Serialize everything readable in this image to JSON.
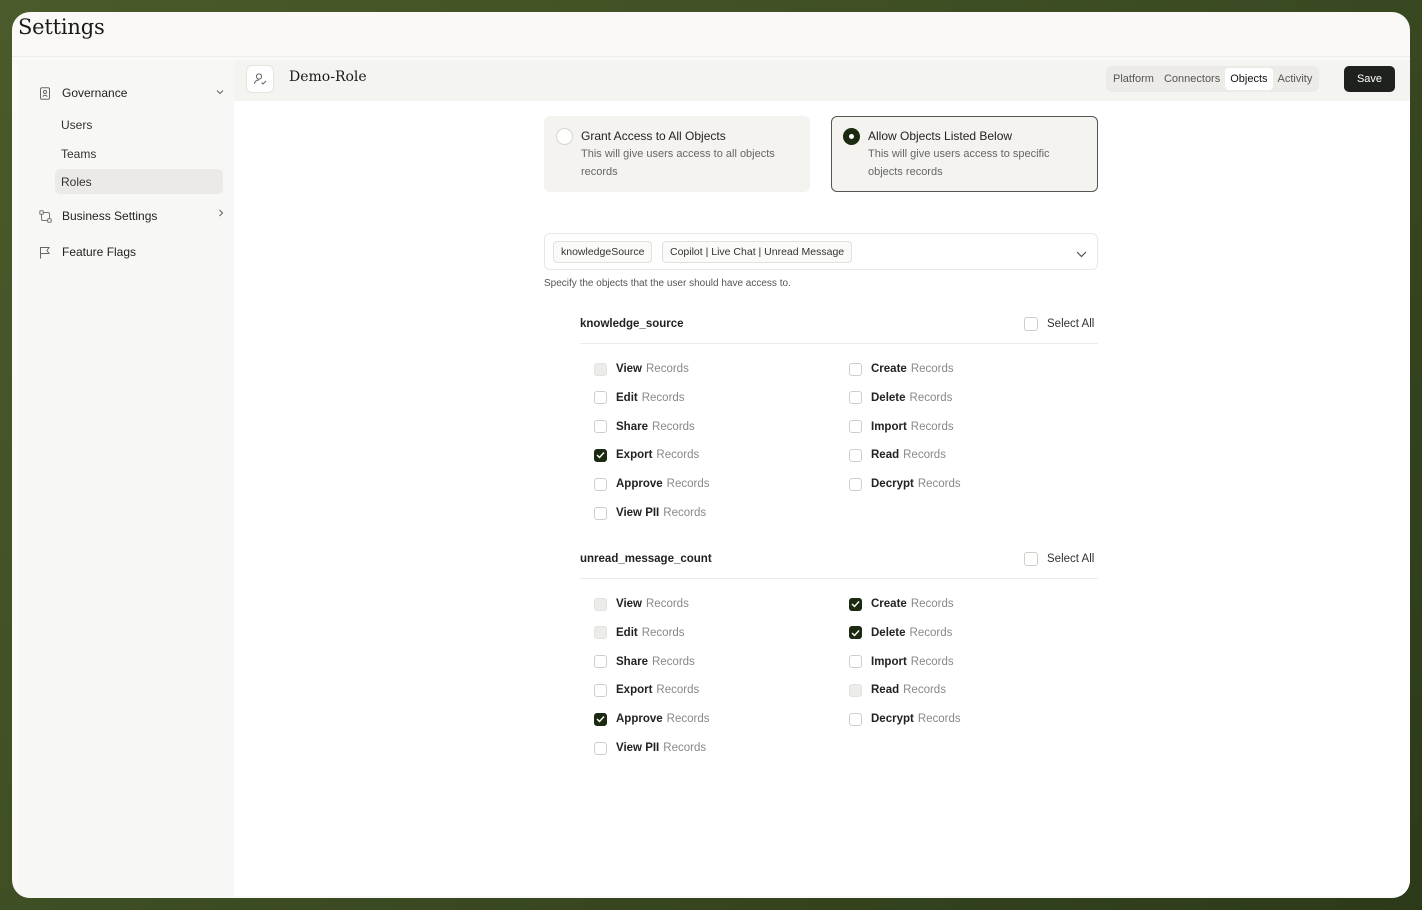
{
  "app": {
    "title": "Settings"
  },
  "sidebar": {
    "governance": {
      "label": "Governance",
      "items": [
        {
          "label": "Users"
        },
        {
          "label": "Teams"
        },
        {
          "label": "Roles"
        }
      ]
    },
    "business_settings": {
      "label": "Business Settings"
    },
    "feature_flags": {
      "label": "Feature Flags"
    }
  },
  "header": {
    "role_name": "Demo-Role",
    "tabs": [
      {
        "label": "Platform"
      },
      {
        "label": "Connectors"
      },
      {
        "label": "Objects"
      },
      {
        "label": "Activity"
      }
    ],
    "active_tab": "Objects",
    "save_label": "Save"
  },
  "access": {
    "options": [
      {
        "title": "Grant Access to All Objects",
        "desc": "This will give users access to all objects records",
        "selected": false
      },
      {
        "title": "Allow Objects Listed Below",
        "desc": "This will give users access to specific objects records",
        "selected": true
      }
    ]
  },
  "objects_select": {
    "chips": [
      "knowledgeSource",
      "Copilot | Live Chat | Unread Message"
    ],
    "helper": "Specify the objects that the user should have access to."
  },
  "records_word": "Records",
  "select_all_label": "Select All",
  "objects": [
    {
      "name": "knowledge_source",
      "perms": [
        {
          "name": "View",
          "state": "disabled"
        },
        {
          "name": "Create",
          "state": "unchecked"
        },
        {
          "name": "Edit",
          "state": "unchecked"
        },
        {
          "name": "Delete",
          "state": "unchecked"
        },
        {
          "name": "Share",
          "state": "unchecked"
        },
        {
          "name": "Import",
          "state": "unchecked"
        },
        {
          "name": "Export",
          "state": "checked"
        },
        {
          "name": "Read",
          "state": "unchecked"
        },
        {
          "name": "Approve",
          "state": "unchecked"
        },
        {
          "name": "Decrypt",
          "state": "unchecked"
        },
        {
          "name": "View PII",
          "state": "unchecked"
        }
      ]
    },
    {
      "name": "unread_message_count",
      "perms": [
        {
          "name": "View",
          "state": "disabled"
        },
        {
          "name": "Create",
          "state": "checked"
        },
        {
          "name": "Edit",
          "state": "disabled"
        },
        {
          "name": "Delete",
          "state": "checked"
        },
        {
          "name": "Share",
          "state": "unchecked"
        },
        {
          "name": "Import",
          "state": "unchecked"
        },
        {
          "name": "Export",
          "state": "unchecked"
        },
        {
          "name": "Read",
          "state": "disabled"
        },
        {
          "name": "Approve",
          "state": "checked"
        },
        {
          "name": "Decrypt",
          "state": "unchecked"
        },
        {
          "name": "View PII",
          "state": "unchecked"
        }
      ]
    }
  ],
  "colors": {
    "accent": "#1d2a12",
    "save_bg": "#1f211d",
    "frame_bg": "#4a5a2a"
  }
}
